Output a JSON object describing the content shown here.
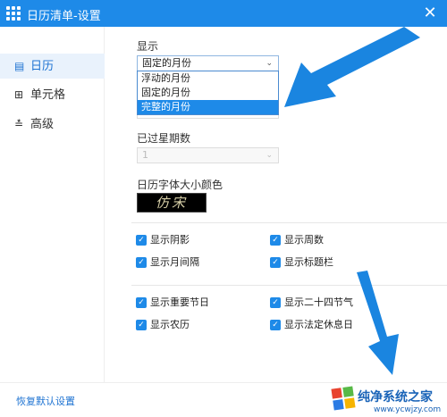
{
  "window": {
    "title": "日历清单-设置",
    "close_glyph": "✕"
  },
  "sidebar": {
    "items": [
      {
        "label": "日历",
        "icon": "calendar-icon"
      },
      {
        "label": "单元格",
        "icon": "grid-icon"
      },
      {
        "label": "高级",
        "icon": "sliders-icon"
      }
    ]
  },
  "display": {
    "label": "显示",
    "selected": "固定的月份",
    "options": [
      "浮动的月份",
      "固定的月份",
      "完整的月份"
    ],
    "highlighted": "完整的月份"
  },
  "weeks_passed": {
    "label": "已过星期数",
    "value": "1"
  },
  "font_color": {
    "label": "日历字体大小颜色",
    "preview_text": "仿宋"
  },
  "checkboxes_1": [
    {
      "label": "显示阴影",
      "checked": true
    },
    {
      "label": "显示周数",
      "checked": true
    },
    {
      "label": "显示月间隔",
      "checked": true
    },
    {
      "label": "显示标题栏",
      "checked": true
    }
  ],
  "checkboxes_2": [
    {
      "label": "显示重要节日",
      "checked": true
    },
    {
      "label": "显示二十四节气",
      "checked": true
    },
    {
      "label": "显示农历",
      "checked": true
    },
    {
      "label": "显示法定休息日",
      "checked": true
    }
  ],
  "footer": {
    "reset_label": "恢复默认设置"
  },
  "watermark": {
    "title": "纯净系统之家",
    "url": "www.ycwjzy.com"
  },
  "colors": {
    "titlebar": "#1e8ae8",
    "accent": "#1e8ae8",
    "arrow": "#1a85e0"
  }
}
